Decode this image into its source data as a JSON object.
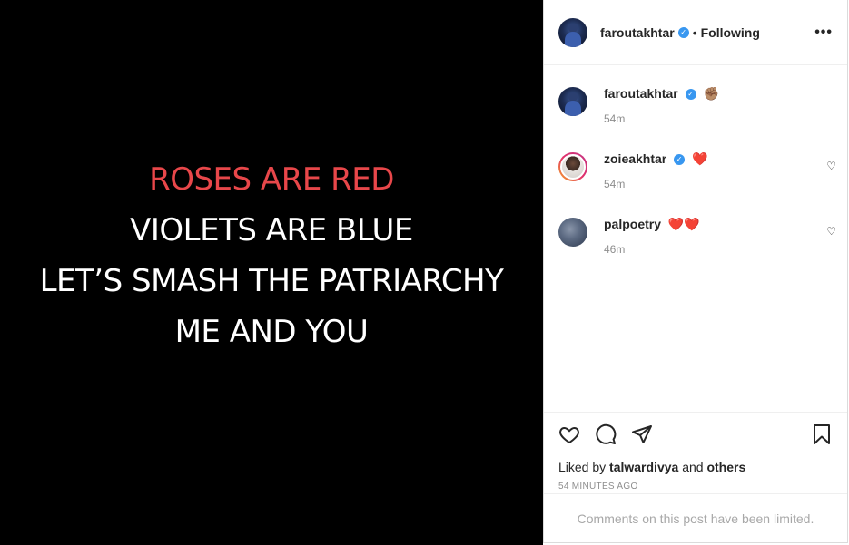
{
  "poem": {
    "line1": "ROSES ARE RED",
    "line2": "VIOLETS ARE BLUE",
    "line3": "LET’S SMASH THE PATRIARCHY",
    "line4": "ME AND YOU",
    "accent_color": "#e8474a"
  },
  "header": {
    "username": "faroutakhtar",
    "verified": true,
    "separator": "•",
    "follow_status": "Following",
    "more_icon": "more-horizontal-icon"
  },
  "comments": [
    {
      "username": "faroutakhtar",
      "verified": true,
      "emoji": "✊🏽",
      "time": "54m",
      "has_like": false
    },
    {
      "username": "zoieakhtar",
      "verified": true,
      "emoji": "❤️",
      "time": "54m",
      "has_like": true
    },
    {
      "username": "palpoetry",
      "verified": false,
      "emoji": "❤️❤️",
      "time": "46m",
      "has_like": true
    }
  ],
  "actions": {
    "icons": [
      "heart-icon",
      "comment-icon",
      "share-icon",
      "bookmark-icon"
    ],
    "liked_prefix": "Liked by",
    "liked_user": "talwardivya",
    "liked_and": "and",
    "liked_others": "others",
    "timestamp": "54 MINUTES AGO"
  },
  "footer": {
    "limited_text": "Comments on this post have been limited."
  }
}
